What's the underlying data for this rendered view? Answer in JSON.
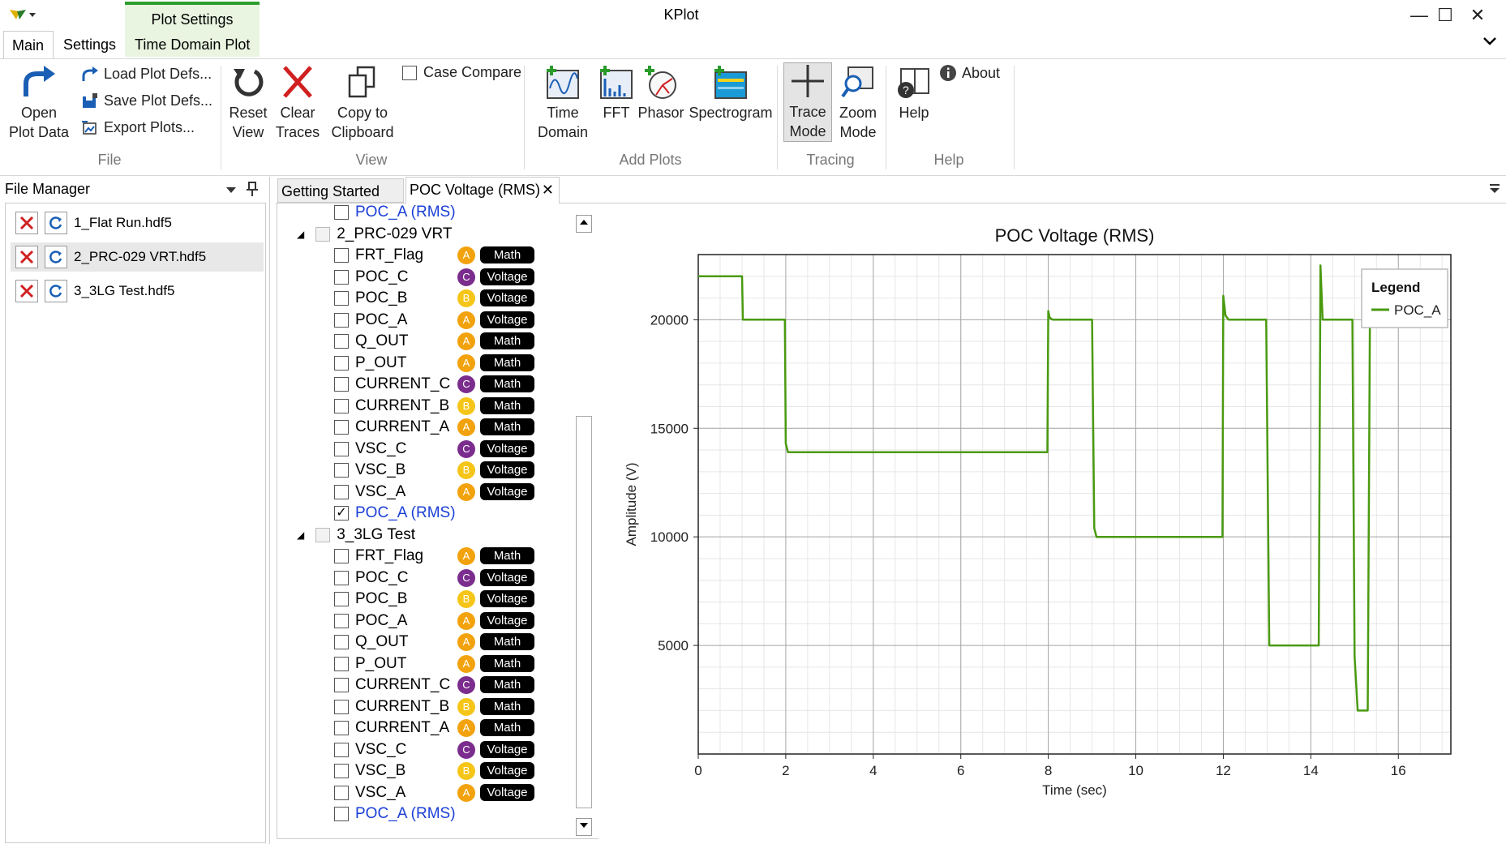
{
  "app": {
    "title": "KPlot",
    "window_controls": [
      "—",
      "☐",
      "✕"
    ]
  },
  "ribbon_tabs": {
    "main": "Main",
    "settings": "Settings",
    "context_group": "Plot Settings",
    "context_tab": "Time Domain Plot"
  },
  "ribbon": {
    "file": {
      "group_label": "File",
      "open": "Open Plot Data",
      "load": "Load Plot Defs...",
      "save": "Save Plot Defs...",
      "export": "Export Plots..."
    },
    "view": {
      "group_label": "View",
      "reset": "Reset View",
      "clear": "Clear Traces",
      "copy": "Copy to Clipboard",
      "case_compare": "Case Compare"
    },
    "add_plots": {
      "group_label": "Add Plots",
      "time_domain": "Time Domain",
      "fft": "FFT",
      "phasor": "Phasor",
      "spectrogram": "Spectrogram"
    },
    "tracing": {
      "group_label": "Tracing",
      "trace": "Trace Mode",
      "zoom": "Zoom Mode"
    },
    "help": {
      "group_label": "Help",
      "help": "Help",
      "about": "About"
    }
  },
  "file_manager": {
    "title": "File Manager",
    "files": [
      "1_Flat Run.hdf5",
      "2_PRC-029 VRT.hdf5",
      "3_3LG Test.hdf5"
    ]
  },
  "doc_tabs": {
    "getting_started": "Getting Started",
    "poc": "POC Voltage (RMS)"
  },
  "tree": {
    "top_item": "POC_A (RMS)",
    "groups": [
      {
        "name": "2_PRC-029 VRT",
        "signals": [
          {
            "name": "FRT_Flag",
            "phase": "A",
            "type": "Math"
          },
          {
            "name": "POC_C",
            "phase": "C",
            "type": "Voltage"
          },
          {
            "name": "POC_B",
            "phase": "B",
            "type": "Voltage"
          },
          {
            "name": "POC_A",
            "phase": "A",
            "type": "Voltage"
          },
          {
            "name": "Q_OUT",
            "phase": "A",
            "type": "Math"
          },
          {
            "name": "P_OUT",
            "phase": "A",
            "type": "Math"
          },
          {
            "name": "CURRENT_C",
            "phase": "C",
            "type": "Math"
          },
          {
            "name": "CURRENT_B",
            "phase": "B",
            "type": "Math"
          },
          {
            "name": "CURRENT_A",
            "phase": "A",
            "type": "Math"
          },
          {
            "name": "VSC_C",
            "phase": "C",
            "type": "Voltage"
          },
          {
            "name": "VSC_B",
            "phase": "B",
            "type": "Voltage"
          },
          {
            "name": "VSC_A",
            "phase": "A",
            "type": "Voltage"
          }
        ],
        "rms_item": "POC_A (RMS)",
        "rms_checked": true
      },
      {
        "name": "3_3LG Test",
        "signals": [
          {
            "name": "FRT_Flag",
            "phase": "A",
            "type": "Math"
          },
          {
            "name": "POC_C",
            "phase": "C",
            "type": "Voltage"
          },
          {
            "name": "POC_B",
            "phase": "B",
            "type": "Voltage"
          },
          {
            "name": "POC_A",
            "phase": "A",
            "type": "Voltage"
          },
          {
            "name": "Q_OUT",
            "phase": "A",
            "type": "Math"
          },
          {
            "name": "P_OUT",
            "phase": "A",
            "type": "Math"
          },
          {
            "name": "CURRENT_C",
            "phase": "C",
            "type": "Math"
          },
          {
            "name": "CURRENT_B",
            "phase": "B",
            "type": "Math"
          },
          {
            "name": "CURRENT_A",
            "phase": "A",
            "type": "Math"
          },
          {
            "name": "VSC_C",
            "phase": "C",
            "type": "Voltage"
          },
          {
            "name": "VSC_B",
            "phase": "B",
            "type": "Voltage"
          },
          {
            "name": "VSC_A",
            "phase": "A",
            "type": "Voltage"
          }
        ],
        "rms_item": "POC_A (RMS)",
        "rms_checked": false
      }
    ]
  },
  "chart_data": {
    "type": "line",
    "title": "POC Voltage (RMS)",
    "xlabel": "Time (sec)",
    "ylabel": "Amplitude (V)",
    "xlim": [
      0,
      17.2
    ],
    "ylim": [
      0,
      23000
    ],
    "xticks": [
      0,
      2,
      4,
      6,
      8,
      10,
      12,
      14,
      16
    ],
    "yticks": [
      5000,
      10000,
      15000,
      20000
    ],
    "grid": true,
    "legend_title": "Legend",
    "legend_position": "top-right",
    "series": [
      {
        "name": "POC_A",
        "color": "#4a9a10",
        "x": [
          0,
          1.0,
          1.02,
          1.98,
          2.0,
          2.05,
          7.98,
          8.0,
          8.03,
          8.1,
          9.0,
          9.05,
          9.1,
          11.98,
          12.0,
          12.05,
          12.12,
          12.98,
          13.05,
          13.1,
          14.18,
          14.22,
          14.27,
          14.33,
          14.95,
          15.0,
          15.07,
          15.12,
          15.3,
          15.35
        ],
        "y": [
          22000,
          22000,
          20000,
          20000,
          14300,
          13900,
          13900,
          20400,
          20100,
          20000,
          20000,
          10400,
          10000,
          10000,
          21100,
          20200,
          20000,
          20000,
          5000,
          5000,
          5000,
          22500,
          20000,
          20000,
          20000,
          4500,
          2000,
          2000,
          2000,
          20000
        ]
      }
    ]
  }
}
